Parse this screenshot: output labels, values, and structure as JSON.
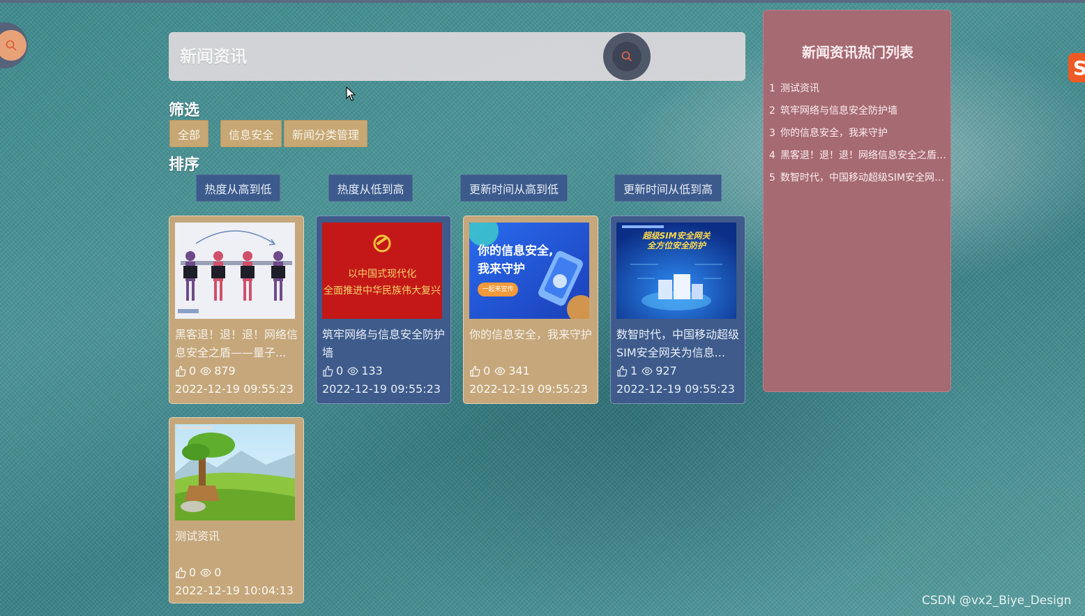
{
  "search": {
    "placeholder": "新闻资讯"
  },
  "filter": {
    "label": "筛选",
    "options": [
      "全部",
      "信息安全",
      "新闻分类管理"
    ]
  },
  "sort": {
    "label": "排序",
    "options": [
      "热度从高到低",
      "热度从低到高",
      "更新时间从高到低",
      "更新时间从低到高"
    ]
  },
  "news": [
    {
      "title": "黑客退！退！退！网络信息安全之盾——量子...",
      "likes": "0",
      "views": "879",
      "date": "2022-12-19 09:55:23"
    },
    {
      "title": "筑牢网络与信息安全防护墙",
      "likes": "0",
      "views": "133",
      "date": "2022-12-19 09:55:23",
      "thumb_text": [
        "以中国式现代化",
        "全面推进中华民族伟大复兴"
      ]
    },
    {
      "title": "你的信息安全，我来守护",
      "likes": "0",
      "views": "341",
      "date": "2022-12-19 09:55:23",
      "thumb_text": [
        "你的信息安全,",
        "我来守护",
        "一起来宣传"
      ]
    },
    {
      "title": "数智时代，中国移动超级SIM安全网关为信息...",
      "likes": "1",
      "views": "927",
      "date": "2022-12-19 09:55:23",
      "thumb_text": [
        "超级SIM安全网关",
        "全方位安全防护"
      ]
    },
    {
      "title": "测试资讯",
      "likes": "0",
      "views": "0",
      "date": "2022-12-19 10:04:13"
    }
  ],
  "hot": {
    "title": "新闻资讯热门列表",
    "items": [
      {
        "num": "1",
        "text": "测试资讯"
      },
      {
        "num": "2",
        "text": "筑牢网络与信息安全防护墙"
      },
      {
        "num": "3",
        "text": "你的信息安全，我来守护"
      },
      {
        "num": "4",
        "text": "黑客退！退！退！网络信息安全之盾——量子加密"
      },
      {
        "num": "5",
        "text": "数智时代，中国移动超级SIM安全网关为信息安全护航"
      }
    ]
  },
  "watermark": "CSDN @vx2_Biye_Design",
  "colors": {
    "filter_button": "#c7a874",
    "sort_button": "#3c5a8c",
    "hot_panel": "#a66a72",
    "card_tan": "#c5a77b",
    "card_blue": "#3e5b8b"
  }
}
